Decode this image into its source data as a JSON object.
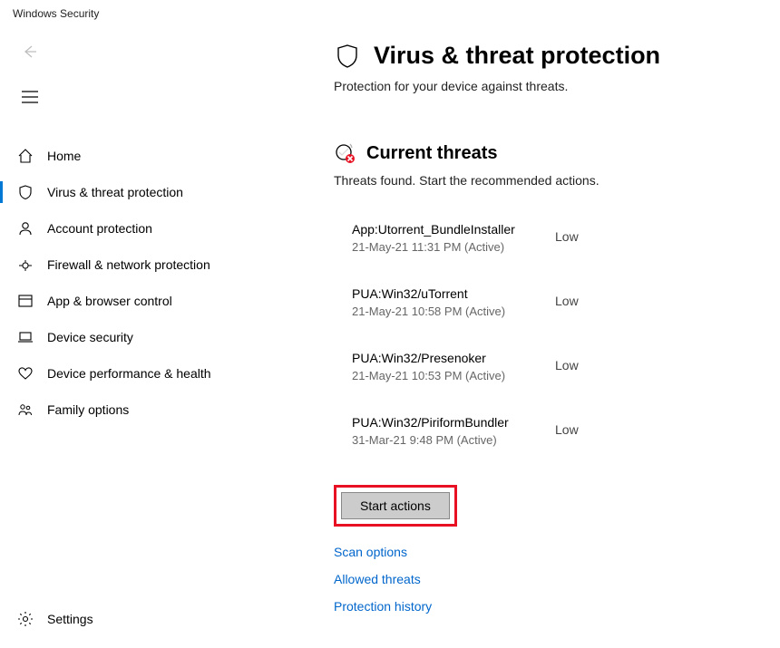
{
  "window": {
    "title": "Windows Security"
  },
  "nav": {
    "items": [
      {
        "label": "Home"
      },
      {
        "label": "Virus & threat protection"
      },
      {
        "label": "Account protection"
      },
      {
        "label": "Firewall & network protection"
      },
      {
        "label": "App & browser control"
      },
      {
        "label": "Device security"
      },
      {
        "label": "Device performance & health"
      },
      {
        "label": "Family options"
      }
    ],
    "settings_label": "Settings"
  },
  "page": {
    "title": "Virus & threat protection",
    "subtitle": "Protection for your device against threats."
  },
  "threats_section": {
    "title": "Current threats",
    "subtitle": "Threats found. Start the recommended actions.",
    "items": [
      {
        "name": "App:Utorrent_BundleInstaller",
        "meta": "21-May-21 11:31 PM (Active)",
        "severity": "Low"
      },
      {
        "name": "PUA:Win32/uTorrent",
        "meta": "21-May-21 10:58 PM (Active)",
        "severity": "Low"
      },
      {
        "name": "PUA:Win32/Presenoker",
        "meta": "21-May-21 10:53 PM (Active)",
        "severity": "Low"
      },
      {
        "name": "PUA:Win32/PiriformBundler",
        "meta": "31-Mar-21 9:48 PM (Active)",
        "severity": "Low"
      }
    ],
    "start_actions_label": "Start actions",
    "links": {
      "scan_options": "Scan options",
      "allowed_threats": "Allowed threats",
      "protection_history": "Protection history"
    }
  }
}
